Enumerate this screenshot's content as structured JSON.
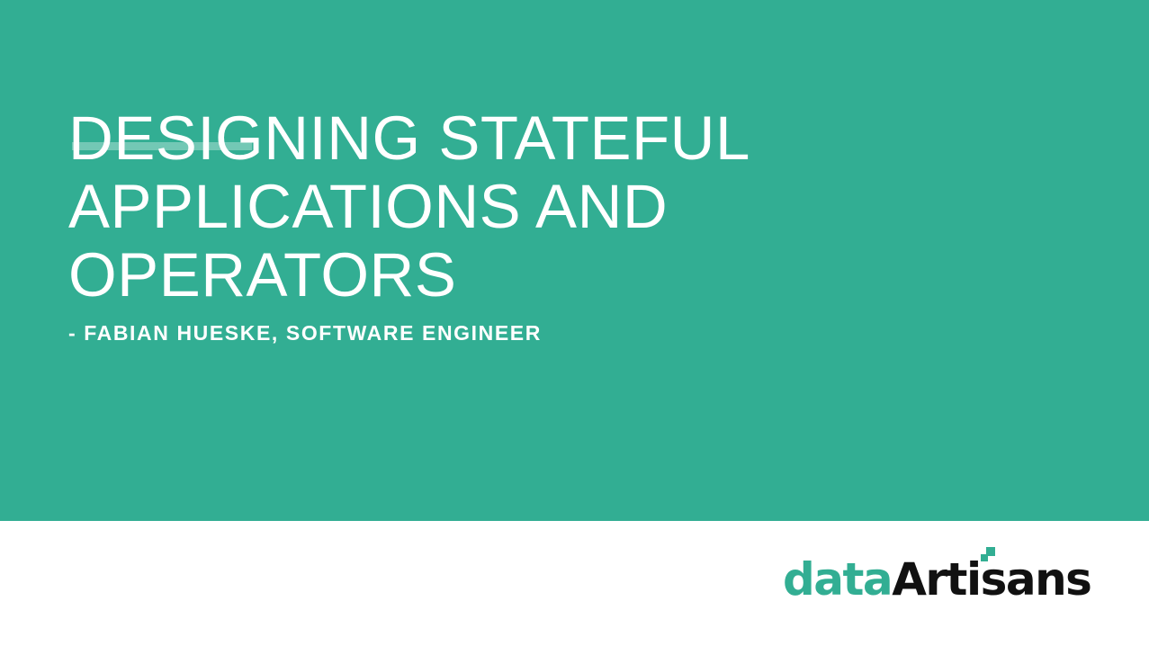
{
  "slide": {
    "title_lines": [
      "DESIGNING STATEFUL",
      "APPLICATIONS AND",
      "OPERATORS"
    ],
    "subtitle": "- FABIAN HUESKE, SOFTWARE ENGINEER"
  },
  "logo": {
    "part1": "data",
    "part2": "Artisans",
    "icon": "data-artisans-squares-icon"
  },
  "colors": {
    "brand": "#32ae93",
    "logo_dark": "#111111",
    "background": "#ffffff"
  }
}
